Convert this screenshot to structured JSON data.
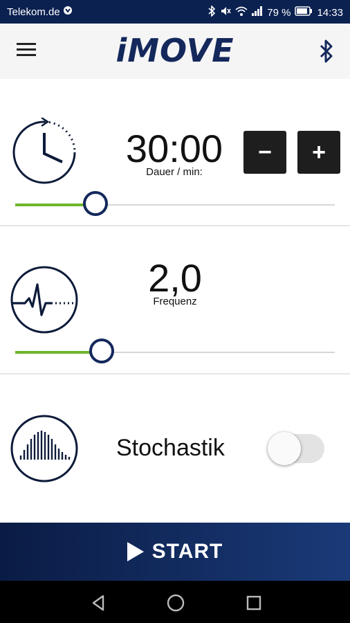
{
  "status_bar": {
    "carrier": "Telekom.de",
    "battery": "79 %",
    "time": "14:33"
  },
  "app_bar": {
    "logo": "iMOVE"
  },
  "duration": {
    "value": "30:00",
    "label": "Dauer / min:",
    "minus_label": "−",
    "plus_label": "+",
    "slider_level": 0.25
  },
  "frequency": {
    "value": "2,0",
    "label": "Frequenz",
    "slider_level": 0.27
  },
  "stochastik": {
    "label": "Stochastik",
    "enabled": false
  },
  "start": {
    "label": "START"
  },
  "colors": {
    "brand": "#14285c",
    "status_bar": "#0b2150",
    "slider_fill": "#6fb52c"
  },
  "icons": {
    "clock": "clock-icon",
    "heartbeat": "pulse-wave-icon",
    "histogram": "bell-curve-icon",
    "bluetooth": "bluetooth-icon",
    "menu": "hamburger-menu-icon"
  }
}
